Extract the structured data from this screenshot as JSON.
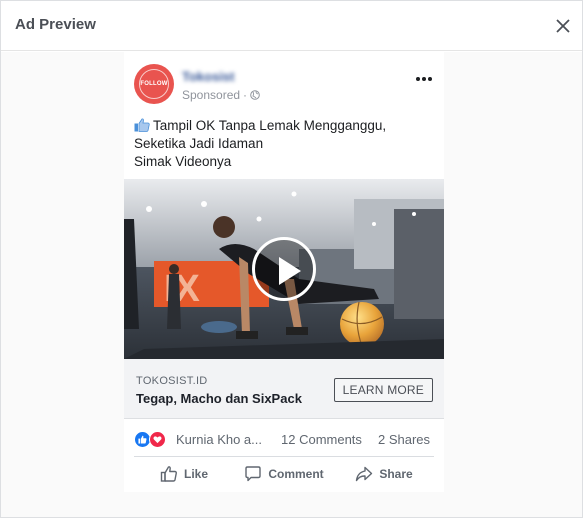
{
  "modal": {
    "title": "Ad Preview"
  },
  "post": {
    "avatar": {
      "label": "FOLLOW",
      "color": "#e9544f"
    },
    "page_name": "Tokosist",
    "sponsored_label": "Sponsored",
    "separator": "·",
    "caption_lines": [
      "Tampil OK Tanpa Lemak Mengganggu,",
      "Seketika Jadi Idaman",
      "Simak Videonya"
    ],
    "link": {
      "domain": "TOKOSIST.ID",
      "headline": "Tegap, Macho dan SixPack",
      "cta": "LEARN MORE"
    },
    "engagement": {
      "reactor_name": "Kurnia Kho a...",
      "comments": "12 Comments",
      "shares": "2 Shares"
    },
    "actions": {
      "like": "Like",
      "comment": "Comment",
      "share": "Share"
    }
  },
  "colors": {
    "like_blue": "#1877f2",
    "love_red": "#f0284a",
    "text_secondary": "#606770"
  },
  "icons": [
    "close-icon",
    "more-options-icon",
    "globe-icon",
    "thumbs-up-icon",
    "like-reaction-icon",
    "love-reaction-icon",
    "play-icon",
    "comment-icon",
    "share-icon"
  ]
}
